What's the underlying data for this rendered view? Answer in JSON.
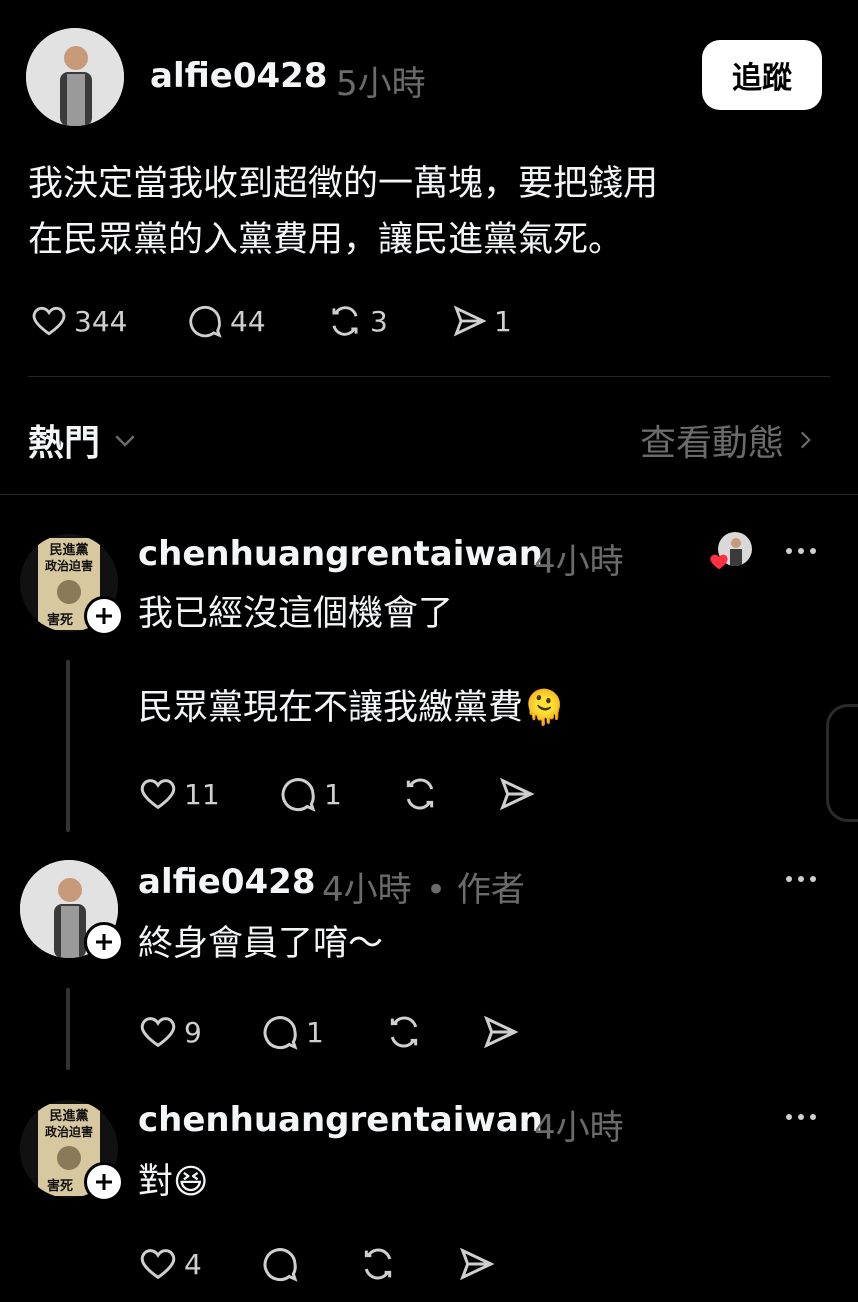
{
  "post": {
    "username": "alfie0428",
    "time": "5小時",
    "follow_label": "追蹤",
    "text_line1": "我決定當我收到超徵的一萬塊，要把錢用",
    "text_line2": "在民眾黨的入黨費用，讓民進黨氣死。",
    "likes": "344",
    "comments": "44",
    "reposts": "3",
    "shares": "1"
  },
  "sort": {
    "label": "熱門",
    "activity_link": "查看動態"
  },
  "poster_text": {
    "line1": "民進黨",
    "line2": "政治迫害",
    "line3": "害死"
  },
  "replies": [
    {
      "username": "chenhuangrentaiwan",
      "time": "4小時",
      "text": "我已經沒這個機會了",
      "text2": "民眾黨現在不讓我繳黨費",
      "emoji": "🫠",
      "likes": "11",
      "comments": "1"
    },
    {
      "username": "alfie0428",
      "time": "4小時",
      "author_tag": "• 作者",
      "text": "終身會員了唷～",
      "likes": "9",
      "comments": "1"
    },
    {
      "username": "chenhuangrentaiwan",
      "time": "4小時",
      "text": "對",
      "emoji": "😆",
      "likes": "4"
    }
  ],
  "colors": {
    "background": "#000000",
    "text": "#f3f5f7",
    "muted": "#6b6b6b",
    "like_heart": "#ff3040",
    "divider": "#262626"
  }
}
